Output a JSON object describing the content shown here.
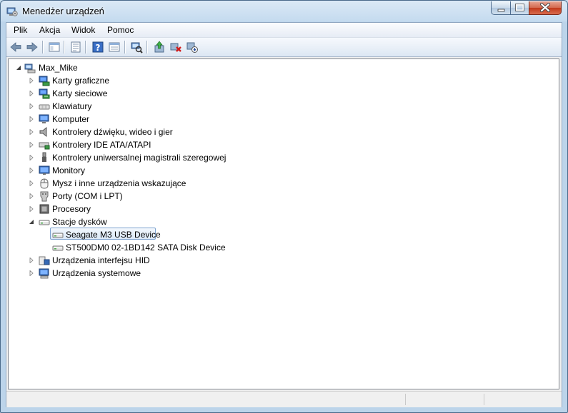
{
  "window": {
    "title": "Menedżer urządzeń"
  },
  "menu": {
    "items": [
      "Plik",
      "Akcja",
      "Widok",
      "Pomoc"
    ]
  },
  "toolbar": {
    "buttons": [
      {
        "icon": "back-arrow-icon"
      },
      {
        "icon": "forward-arrow-icon"
      },
      {
        "icon": "show-hide-tree-icon"
      },
      {
        "icon": "properties-icon"
      },
      {
        "icon": "help-icon"
      },
      {
        "icon": "console-view-icon"
      },
      {
        "icon": "scan-hardware-icon"
      },
      {
        "icon": "update-driver-icon"
      },
      {
        "icon": "uninstall-icon"
      },
      {
        "icon": "disable-device-icon"
      }
    ]
  },
  "tree": {
    "root": {
      "label": "Max_Mike",
      "icon": "computer-root-icon"
    },
    "categories": [
      {
        "label": "Karty graficzne",
        "icon": "display-adapter-icon"
      },
      {
        "label": "Karty sieciowe",
        "icon": "network-adapter-icon"
      },
      {
        "label": "Klawiatury",
        "icon": "keyboard-icon"
      },
      {
        "label": "Komputer",
        "icon": "computer-icon"
      },
      {
        "label": "Kontrolery dźwięku, wideo i gier",
        "icon": "speaker-icon"
      },
      {
        "label": "Kontrolery IDE ATA/ATAPI",
        "icon": "ide-controller-icon"
      },
      {
        "label": "Kontrolery uniwersalnej magistrali szeregowej",
        "icon": "usb-plug-icon"
      },
      {
        "label": "Monitory",
        "icon": "monitor-icon"
      },
      {
        "label": "Mysz i inne urządzenia wskazujące",
        "icon": "mouse-icon"
      },
      {
        "label": "Porty (COM i LPT)",
        "icon": "port-icon"
      },
      {
        "label": "Procesory",
        "icon": "processor-icon"
      },
      {
        "label": "Stacje dysków",
        "icon": "disk-drive-icon",
        "expanded": true,
        "children": [
          {
            "label": "Seagate M3 USB Device",
            "icon": "disk-drive-icon",
            "selected": true
          },
          {
            "label": "ST500DM0 02-1BD142 SATA Disk Device",
            "icon": "disk-drive-icon"
          }
        ]
      },
      {
        "label": "Urządzenia interfejsu HID",
        "icon": "hid-device-icon"
      },
      {
        "label": "Urządzenia systemowe",
        "icon": "system-device-icon"
      }
    ]
  },
  "colors": {
    "selection_border": "#7da2ce",
    "selection_fill": "#dbe9f8"
  }
}
